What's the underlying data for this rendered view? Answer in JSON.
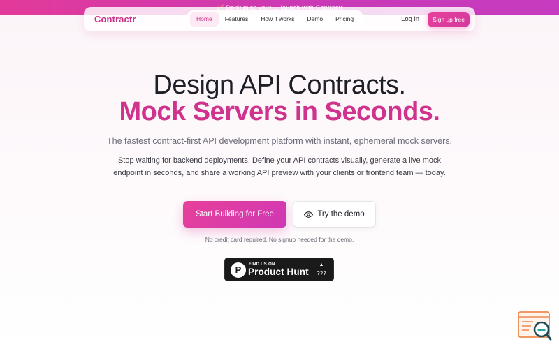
{
  "announcement": {
    "text": "🎉 Don't miss your ... launch with Contractr"
  },
  "brand": {
    "name": "Contractr",
    "color": "#cc2f8a"
  },
  "nav": {
    "links": [
      {
        "label": "Home",
        "active": true
      },
      {
        "label": "Features",
        "active": false
      },
      {
        "label": "How it works",
        "active": false
      },
      {
        "label": "Demo",
        "active": false
      },
      {
        "label": "Pricing",
        "active": false
      }
    ],
    "login_label": "Log in",
    "signup_label": "Sign up free"
  },
  "hero": {
    "headline_line1": "Design API Contracts.",
    "headline_line2": "Mock Servers in Seconds.",
    "subheadline": "The fastest contract-first API development platform with instant, ephemeral mock servers.",
    "description": "Stop waiting for backend deployments. Define your API contracts visually, generate a live mock endpoint in seconds, and share a working API preview with your clients or frontend team — today.",
    "primary_cta": "Start Building for Free",
    "secondary_cta": "Try the demo",
    "note": "No credit card required. No signup needed for the demo."
  },
  "product_hunt": {
    "logo_letter": "P",
    "small_text": "FIND US ON",
    "big_text": "Product Hunt",
    "count": "???"
  },
  "icons": {
    "secondary_cta_icon": "eye-icon",
    "widget_icon": "search-document-icon"
  },
  "colors": {
    "accent": "#d0338d",
    "gradient_start": "#e8409a",
    "gradient_end": "#cf38b4"
  }
}
